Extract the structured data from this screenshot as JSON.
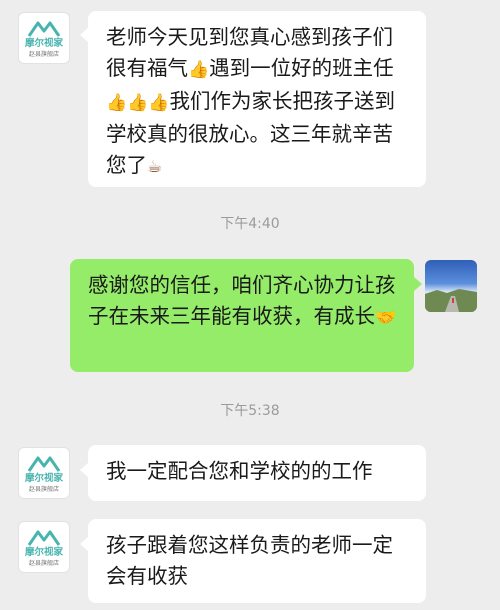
{
  "brand": {
    "name": "摩尔视家",
    "sub": "赵县旗舰店",
    "color": "#48b4ae"
  },
  "messages": [
    {
      "side": "left",
      "parts": [
        "老师今天见到您真心感到孩子们很有福气",
        "{thumbs}",
        "遇到一位好的班主任",
        "{thumbs}",
        "{thumbs}",
        "{thumbs}",
        "我们作为家长把孩子送到学校真的很放心。这三年就辛苦您了",
        "{coffee}"
      ]
    },
    {
      "side": "time",
      "text": "下午4:40"
    },
    {
      "side": "right",
      "parts": [
        "感谢您的信任，咱们齐心协力让孩子在未来三年能有收获，有成长",
        "{handshake}"
      ]
    },
    {
      "side": "time",
      "text": "下午5:38"
    },
    {
      "side": "left",
      "parts": [
        "我一定配合您和学校的的工作"
      ]
    },
    {
      "side": "left",
      "parts": [
        "孩子跟着您这样负责的老师一定会有收获"
      ]
    }
  ],
  "emoji_names": {
    "thumbs": "thumbs-up-icon",
    "coffee": "coffee-icon",
    "handshake": "handshake-icon"
  },
  "colors": {
    "background": "#ededed",
    "incoming": "#ffffff",
    "outgoing": "#95ec69",
    "time": "#9b9b9b"
  }
}
